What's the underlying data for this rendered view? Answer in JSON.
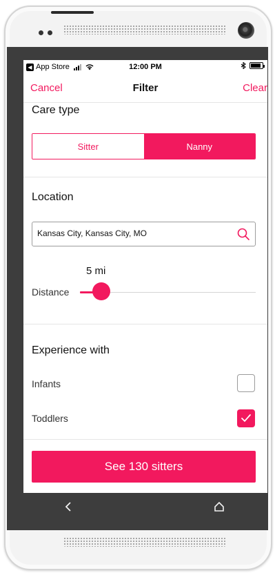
{
  "status_bar": {
    "carrier": "App Store",
    "time": "12:00 PM",
    "bluetooth_icon": "bluetooth-icon",
    "battery_level": 0.9
  },
  "navbar": {
    "cancel_label": "Cancel",
    "title": "Filter",
    "clear_label": "Clear"
  },
  "care_type": {
    "title": "Care type",
    "options": [
      "Sitter",
      "Nanny"
    ],
    "selected": "Nanny"
  },
  "location": {
    "title": "Location",
    "input_value": "Kansas City, Kansas City, MO",
    "distance_value": "5 mi",
    "distance_label": "Distance",
    "distance_level": 0.05
  },
  "experience": {
    "title": "Experience with",
    "items": [
      {
        "label": "Infants",
        "checked": false
      },
      {
        "label": "Toddlers",
        "checked": true
      }
    ]
  },
  "cta_label": "See 130 sitters",
  "colors": {
    "accent": "#f2195e",
    "bezel": "#3d3d3d"
  },
  "icons": {
    "search": "search-icon",
    "back": "back-arrow-icon",
    "home": "home-icon",
    "check": "checkmark-icon"
  }
}
